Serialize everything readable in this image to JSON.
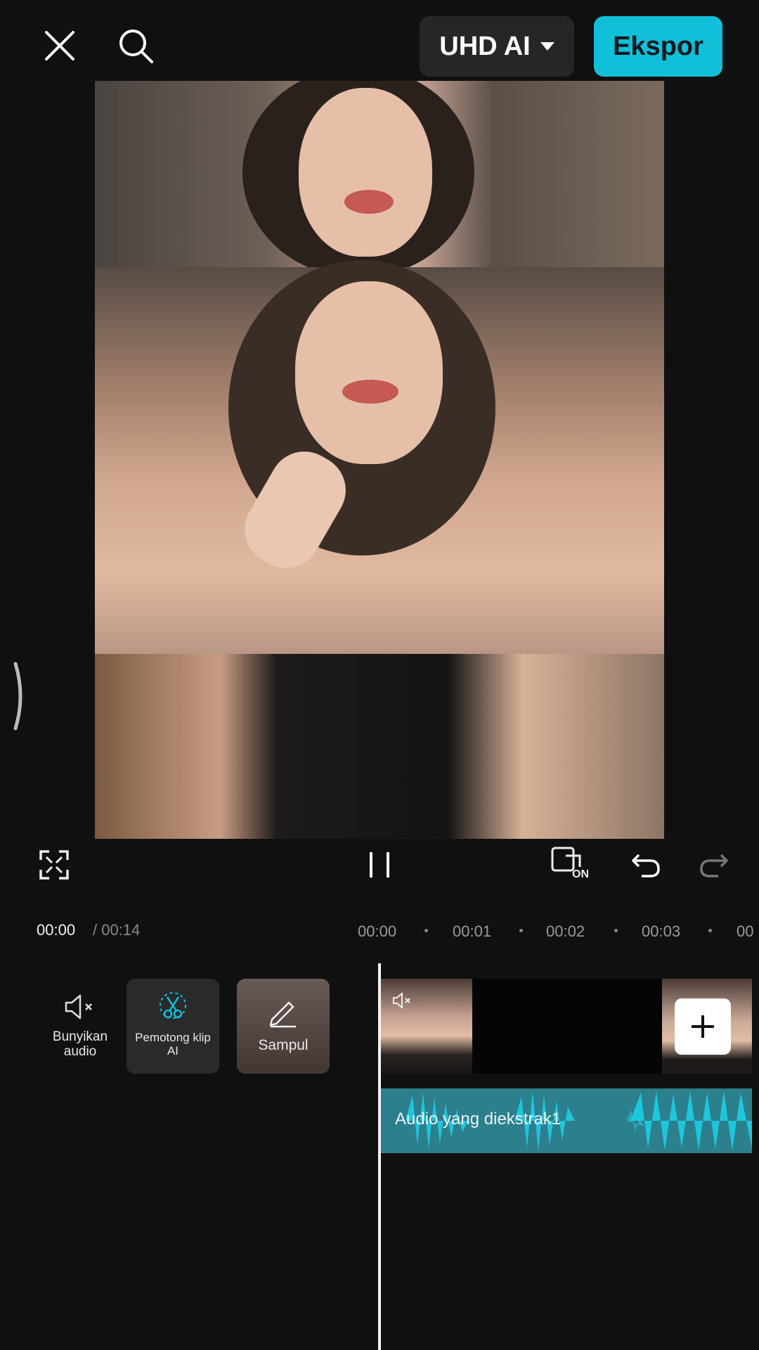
{
  "header": {
    "quality_label": "UHD AI",
    "export_label": "Ekspor"
  },
  "player": {
    "toggle_badge": "ON"
  },
  "time": {
    "current": "00:00",
    "total": "/ 00:14",
    "ruler": [
      "00:00",
      "00:01",
      "00:02",
      "00:03",
      "00"
    ]
  },
  "tools": {
    "mute_label": "Bunyikan audio",
    "cutter_label": "Pemotong klip AI",
    "cover_label": "Sampul"
  },
  "timeline": {
    "audio_label": "Audio yang diekstrak1"
  },
  "colors": {
    "accent": "#12bfd8",
    "background": "#101010",
    "audio_track": "#2c7f8d"
  },
  "icons": [
    "close-icon",
    "search-icon",
    "chevron-down-icon",
    "fullscreen-icon",
    "pause-icon",
    "toggle-on-icon",
    "undo-icon",
    "redo-icon",
    "speaker-mute-icon",
    "scissors-icon",
    "pencil-icon",
    "plus-icon"
  ]
}
